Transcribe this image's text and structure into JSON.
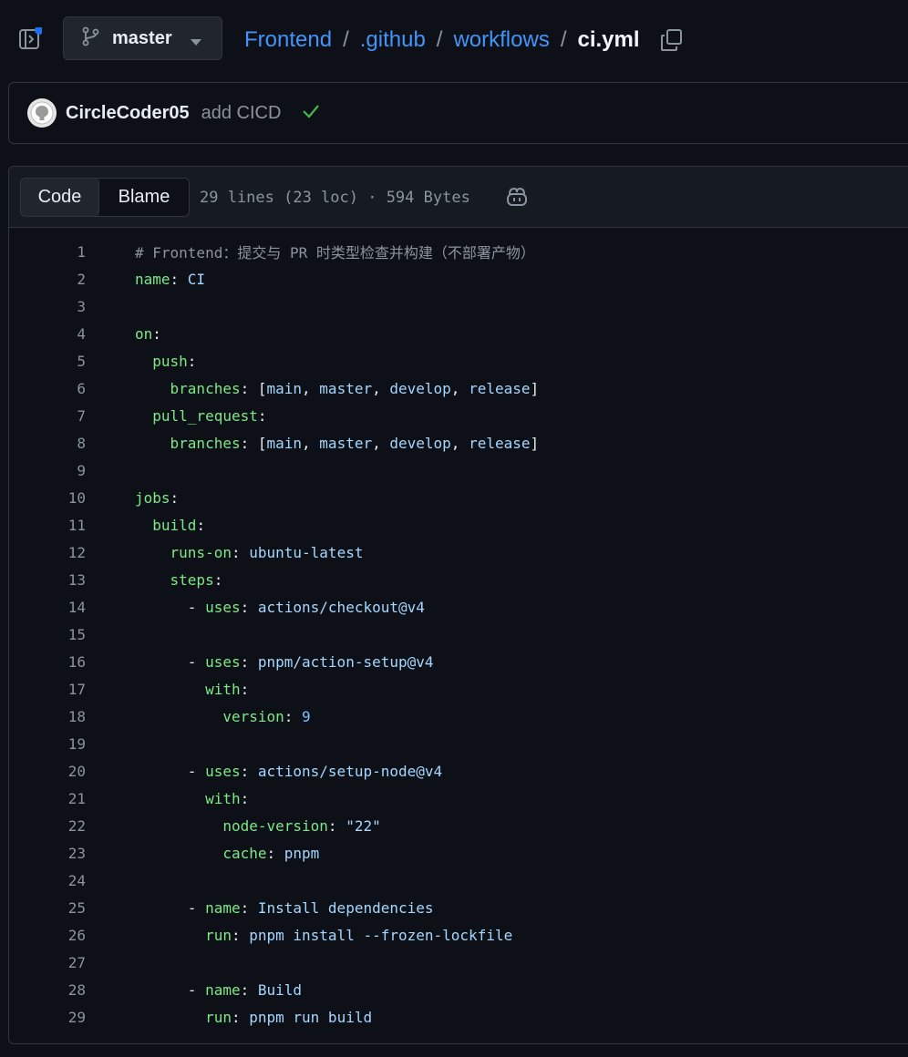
{
  "branch": {
    "name": "master"
  },
  "breadcrumb": {
    "repo": "Frontend",
    "dir1": ".github",
    "dir2": "workflows",
    "file": "ci.yml",
    "separator": "/"
  },
  "commit": {
    "author": "CircleCoder05",
    "message": "add CICD",
    "status_icon": "check-icon"
  },
  "file_header": {
    "tabs": [
      "Code",
      "Blame"
    ],
    "active_tab": "Code",
    "meta": "29 lines (23 loc) · 594 Bytes"
  },
  "colors": {
    "background": "#0d1117",
    "link": "#4493f8",
    "key": "#7ee787",
    "value": "#a5d6ff",
    "comment": "#8b949e",
    "success": "#3fb950"
  },
  "code_lines": [
    [
      {
        "t": "comment",
        "v": "# Frontend：提交与 PR 时类型检查并构建（不部署产物）"
      }
    ],
    [
      {
        "t": "key",
        "v": "name"
      },
      {
        "t": "punc",
        "v": ": "
      },
      {
        "t": "val",
        "v": "CI"
      }
    ],
    [],
    [
      {
        "t": "key",
        "v": "on"
      },
      {
        "t": "punc",
        "v": ":"
      }
    ],
    [
      {
        "t": "punc",
        "v": "  "
      },
      {
        "t": "key",
        "v": "push"
      },
      {
        "t": "punc",
        "v": ":"
      }
    ],
    [
      {
        "t": "punc",
        "v": "    "
      },
      {
        "t": "key",
        "v": "branches"
      },
      {
        "t": "punc",
        "v": ": ["
      },
      {
        "t": "val",
        "v": "main"
      },
      {
        "t": "punc",
        "v": ", "
      },
      {
        "t": "val",
        "v": "master"
      },
      {
        "t": "punc",
        "v": ", "
      },
      {
        "t": "val",
        "v": "develop"
      },
      {
        "t": "punc",
        "v": ", "
      },
      {
        "t": "val",
        "v": "release"
      },
      {
        "t": "punc",
        "v": "]"
      }
    ],
    [
      {
        "t": "punc",
        "v": "  "
      },
      {
        "t": "key",
        "v": "pull_request"
      },
      {
        "t": "punc",
        "v": ":"
      }
    ],
    [
      {
        "t": "punc",
        "v": "    "
      },
      {
        "t": "key",
        "v": "branches"
      },
      {
        "t": "punc",
        "v": ": ["
      },
      {
        "t": "val",
        "v": "main"
      },
      {
        "t": "punc",
        "v": ", "
      },
      {
        "t": "val",
        "v": "master"
      },
      {
        "t": "punc",
        "v": ", "
      },
      {
        "t": "val",
        "v": "develop"
      },
      {
        "t": "punc",
        "v": ", "
      },
      {
        "t": "val",
        "v": "release"
      },
      {
        "t": "punc",
        "v": "]"
      }
    ],
    [],
    [
      {
        "t": "key",
        "v": "jobs"
      },
      {
        "t": "punc",
        "v": ":"
      }
    ],
    [
      {
        "t": "punc",
        "v": "  "
      },
      {
        "t": "key",
        "v": "build"
      },
      {
        "t": "punc",
        "v": ":"
      }
    ],
    [
      {
        "t": "punc",
        "v": "    "
      },
      {
        "t": "key",
        "v": "runs-on"
      },
      {
        "t": "punc",
        "v": ": "
      },
      {
        "t": "val",
        "v": "ubuntu-latest"
      }
    ],
    [
      {
        "t": "punc",
        "v": "    "
      },
      {
        "t": "key",
        "v": "steps"
      },
      {
        "t": "punc",
        "v": ":"
      }
    ],
    [
      {
        "t": "punc",
        "v": "      - "
      },
      {
        "t": "key",
        "v": "uses"
      },
      {
        "t": "punc",
        "v": ": "
      },
      {
        "t": "val",
        "v": "actions/checkout@v4"
      }
    ],
    [],
    [
      {
        "t": "punc",
        "v": "      - "
      },
      {
        "t": "key",
        "v": "uses"
      },
      {
        "t": "punc",
        "v": ": "
      },
      {
        "t": "val",
        "v": "pnpm/action-setup@v4"
      }
    ],
    [
      {
        "t": "punc",
        "v": "        "
      },
      {
        "t": "key",
        "v": "with"
      },
      {
        "t": "punc",
        "v": ":"
      }
    ],
    [
      {
        "t": "punc",
        "v": "          "
      },
      {
        "t": "key",
        "v": "version"
      },
      {
        "t": "punc",
        "v": ": "
      },
      {
        "t": "num",
        "v": "9"
      }
    ],
    [],
    [
      {
        "t": "punc",
        "v": "      - "
      },
      {
        "t": "key",
        "v": "uses"
      },
      {
        "t": "punc",
        "v": ": "
      },
      {
        "t": "val",
        "v": "actions/setup-node@v4"
      }
    ],
    [
      {
        "t": "punc",
        "v": "        "
      },
      {
        "t": "key",
        "v": "with"
      },
      {
        "t": "punc",
        "v": ":"
      }
    ],
    [
      {
        "t": "punc",
        "v": "          "
      },
      {
        "t": "key",
        "v": "node-version"
      },
      {
        "t": "punc",
        "v": ": "
      },
      {
        "t": "val",
        "v": "\"22\""
      }
    ],
    [
      {
        "t": "punc",
        "v": "          "
      },
      {
        "t": "key",
        "v": "cache"
      },
      {
        "t": "punc",
        "v": ": "
      },
      {
        "t": "val",
        "v": "pnpm"
      }
    ],
    [],
    [
      {
        "t": "punc",
        "v": "      - "
      },
      {
        "t": "key",
        "v": "name"
      },
      {
        "t": "punc",
        "v": ": "
      },
      {
        "t": "val",
        "v": "Install dependencies"
      }
    ],
    [
      {
        "t": "punc",
        "v": "        "
      },
      {
        "t": "key",
        "v": "run"
      },
      {
        "t": "punc",
        "v": ": "
      },
      {
        "t": "val",
        "v": "pnpm install --frozen-lockfile"
      }
    ],
    [],
    [
      {
        "t": "punc",
        "v": "      - "
      },
      {
        "t": "key",
        "v": "name"
      },
      {
        "t": "punc",
        "v": ": "
      },
      {
        "t": "val",
        "v": "Build"
      }
    ],
    [
      {
        "t": "punc",
        "v": "        "
      },
      {
        "t": "key",
        "v": "run"
      },
      {
        "t": "punc",
        "v": ": "
      },
      {
        "t": "val",
        "v": "pnpm run build"
      }
    ]
  ]
}
